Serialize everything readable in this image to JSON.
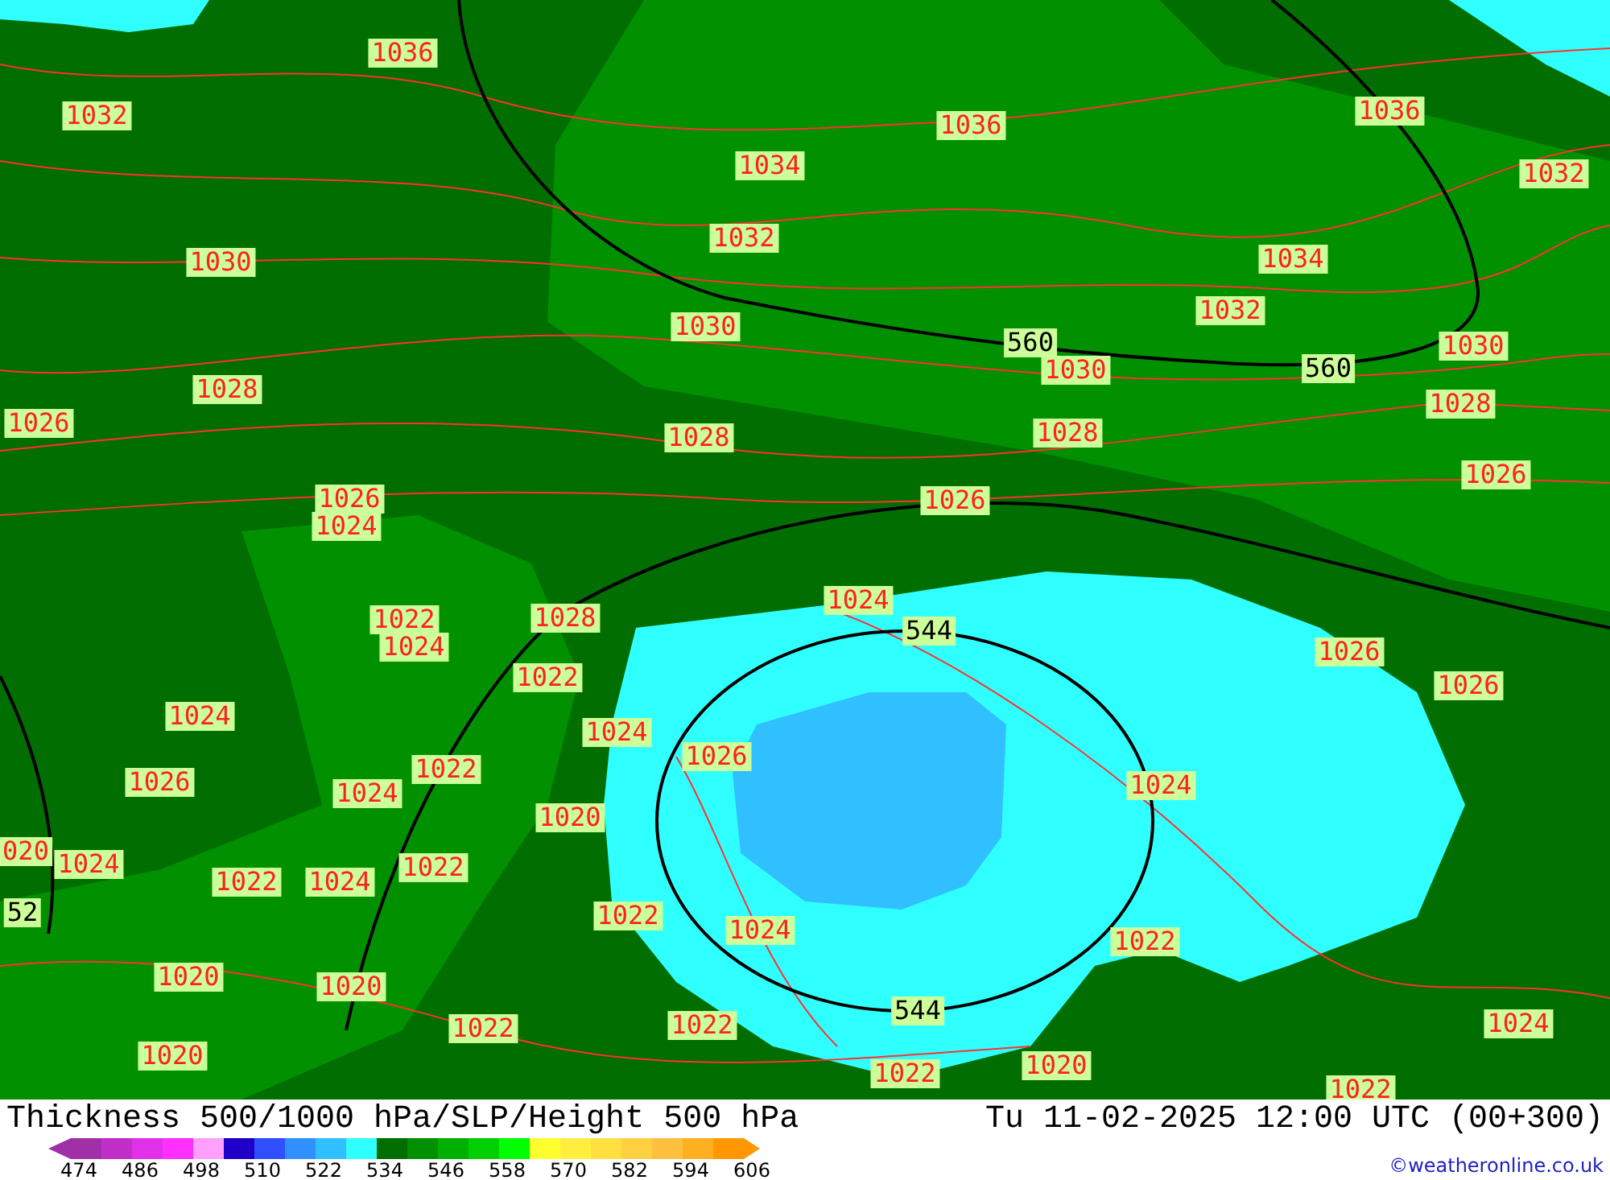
{
  "map": {
    "labels": [
      {
        "text": "1036",
        "kind": "isobar"
      },
      {
        "text": "1032",
        "kind": "isobar"
      },
      {
        "text": "1030",
        "kind": "isobar"
      },
      {
        "text": "1028",
        "kind": "isobar"
      },
      {
        "text": "1026",
        "kind": "isobar"
      },
      {
        "text": "1030",
        "kind": "isobar"
      },
      {
        "text": "1028",
        "kind": "isobar"
      },
      {
        "text": "1026",
        "kind": "isobar"
      },
      {
        "text": "1024",
        "kind": "isobar"
      },
      {
        "text": "1036",
        "kind": "isobar"
      },
      {
        "text": "1034",
        "kind": "isobar"
      },
      {
        "text": "1032",
        "kind": "isobar"
      },
      {
        "text": "1036",
        "kind": "isobar"
      },
      {
        "text": "1032",
        "kind": "isobar"
      },
      {
        "text": "1034",
        "kind": "isobar"
      },
      {
        "text": "1032",
        "kind": "isobar"
      },
      {
        "text": "560",
        "kind": "height"
      },
      {
        "text": "1030",
        "kind": "isobar"
      },
      {
        "text": "560",
        "kind": "height"
      },
      {
        "text": "1030",
        "kind": "isobar"
      },
      {
        "text": "1028",
        "kind": "isobar"
      },
      {
        "text": "1028",
        "kind": "isobar"
      },
      {
        "text": "1026",
        "kind": "isobar"
      },
      {
        "text": "1026",
        "kind": "isobar"
      },
      {
        "text": "1022",
        "kind": "isobar"
      },
      {
        "text": "1024",
        "kind": "isobar"
      },
      {
        "text": "1028",
        "kind": "isobar"
      },
      {
        "text": "1022",
        "kind": "isobar"
      },
      {
        "text": "1024",
        "kind": "isobar"
      },
      {
        "text": "1026",
        "kind": "isobar"
      },
      {
        "text": "1024",
        "kind": "isobar"
      },
      {
        "text": "544",
        "kind": "height"
      },
      {
        "text": "1026",
        "kind": "isobar"
      },
      {
        "text": "1026",
        "kind": "isobar"
      },
      {
        "text": "1024",
        "kind": "isobar"
      },
      {
        "text": "1024",
        "kind": "isobar"
      },
      {
        "text": "1026",
        "kind": "isobar"
      },
      {
        "text": "1024",
        "kind": "isobar"
      },
      {
        "text": "1022",
        "kind": "isobar"
      },
      {
        "text": "1020",
        "kind": "isobar"
      },
      {
        "text": "020",
        "kind": "isobar"
      },
      {
        "text": "1024",
        "kind": "isobar"
      },
      {
        "text": "52",
        "kind": "height"
      },
      {
        "text": "1022",
        "kind": "isobar"
      },
      {
        "text": "1024",
        "kind": "isobar"
      },
      {
        "text": "1022",
        "kind": "isobar"
      },
      {
        "text": "1022",
        "kind": "isobar"
      },
      {
        "text": "1024",
        "kind": "isobar"
      },
      {
        "text": "1022",
        "kind": "isobar"
      },
      {
        "text": "544",
        "kind": "height"
      },
      {
        "text": "1020",
        "kind": "isobar"
      },
      {
        "text": "1020",
        "kind": "isobar"
      },
      {
        "text": "1022",
        "kind": "isobar"
      },
      {
        "text": "1022",
        "kind": "isobar"
      },
      {
        "text": "1020",
        "kind": "isobar"
      },
      {
        "text": "1022",
        "kind": "isobar"
      },
      {
        "text": "1020",
        "kind": "isobar"
      },
      {
        "text": "1024",
        "kind": "isobar"
      },
      {
        "text": "1022",
        "kind": "isobar"
      }
    ]
  },
  "footer": {
    "title": "Thickness 500/1000 hPa/SLP/Height 500 hPa",
    "datetime": "Tu 11-02-2025 12:00 UTC (00+300)",
    "credit": "©weatheronline.co.uk"
  },
  "legend": {
    "swatches": [
      {
        "color": "#a030a8"
      },
      {
        "color": "#c030c8"
      },
      {
        "color": "#e030e8"
      },
      {
        "color": "#ff30ff"
      },
      {
        "color": "#ffa0ff"
      },
      {
        "color": "#2000c8"
      },
      {
        "color": "#3050ff"
      },
      {
        "color": "#3090ff"
      },
      {
        "color": "#30c0ff"
      },
      {
        "color": "#30ffff"
      },
      {
        "color": "#006e00"
      },
      {
        "color": "#009000"
      },
      {
        "color": "#00b000"
      },
      {
        "color": "#00d000"
      },
      {
        "color": "#00ff00"
      },
      {
        "color": "#ffff30"
      },
      {
        "color": "#ffee40"
      },
      {
        "color": "#ffe040"
      },
      {
        "color": "#ffd040"
      },
      {
        "color": "#ffc040"
      },
      {
        "color": "#ffb020"
      },
      {
        "color": "#ff9800"
      }
    ],
    "ticks": [
      "474",
      "486",
      "498",
      "510",
      "522",
      "534",
      "546",
      "558",
      "570",
      "582",
      "594",
      "606"
    ]
  }
}
